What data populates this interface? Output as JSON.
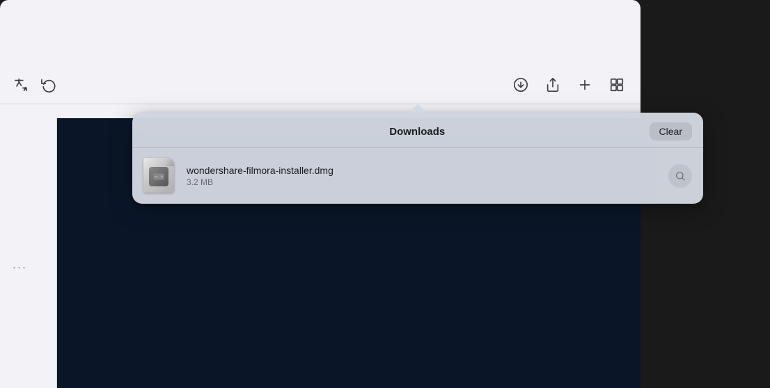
{
  "browser": {
    "toolbar": {
      "translate_icon": "translate",
      "refresh_icon": "refresh",
      "download_icon": "download",
      "share_icon": "share",
      "add_icon": "add-tab",
      "tabs_icon": "tab-overview"
    }
  },
  "sidebar": {
    "dots": "..."
  },
  "popover": {
    "title": "Downloads",
    "clear_button": "Clear",
    "arrow_visible": true
  },
  "download_items": [
    {
      "filename": "wondershare-filmora-installer.dmg",
      "size": "3.2 MB",
      "icon_type": "dmg",
      "action_icon": "magnifier"
    }
  ]
}
